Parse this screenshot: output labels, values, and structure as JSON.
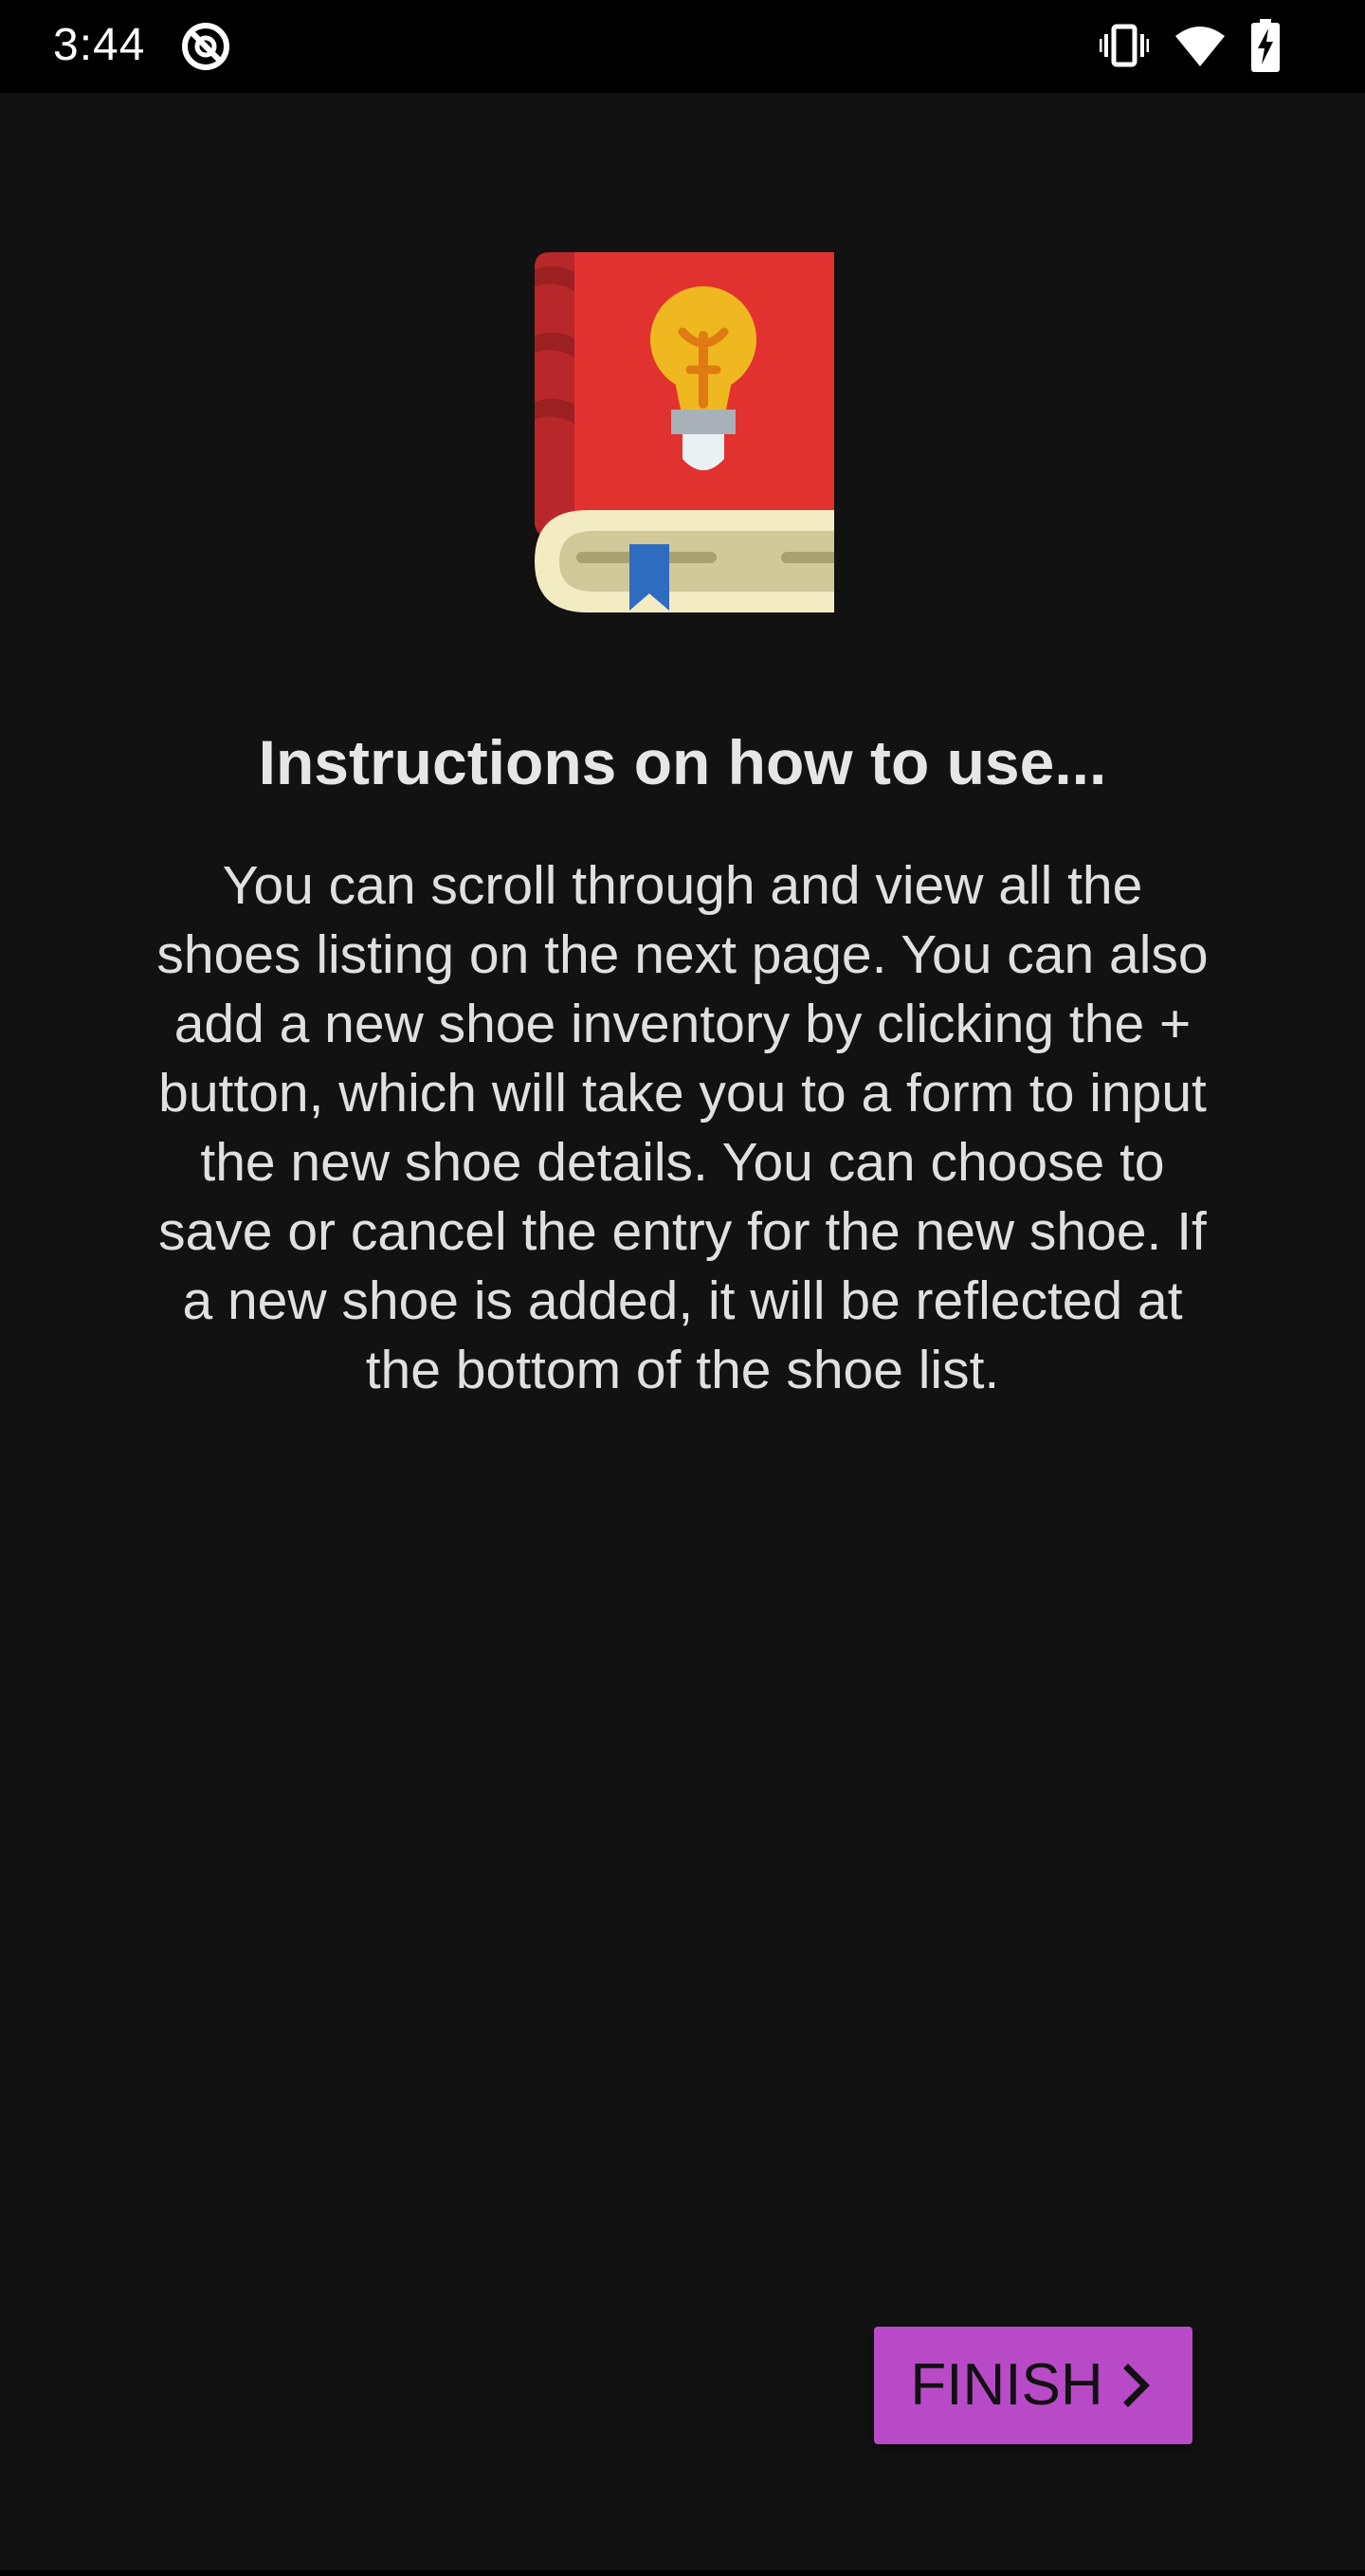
{
  "status_bar": {
    "time": "3:44",
    "icons": [
      "app-notification-icon",
      "vibrate-icon",
      "wifi-icon",
      "battery-charging-icon"
    ]
  },
  "illustration": {
    "icon": "book-lightbulb-icon"
  },
  "content": {
    "title": "Instructions on how to use...",
    "body": "You can scroll through and view all the shoes listing on the next page. You can also add a new shoe inventory by clicking the + button, which will take you to a form to input the new shoe details. You can choose to save or cancel the entry for the new shoe. If a new shoe is added, it will be reflected at the bottom of the shoe list."
  },
  "actions": {
    "finish_label": "FINISH",
    "finish_icon": "chevron-right-icon"
  },
  "colors": {
    "background": "#121212",
    "status_bar": "#000000",
    "accent": "#b84ac7",
    "text_primary": "#e6e6e6"
  }
}
